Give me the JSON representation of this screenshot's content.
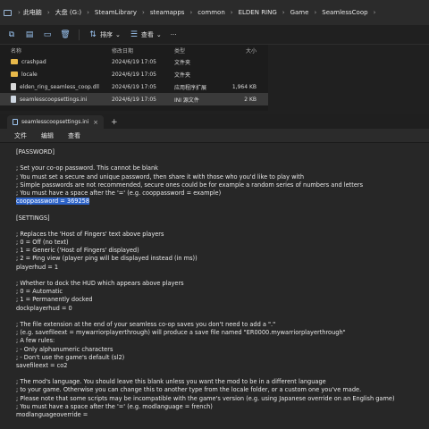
{
  "explorer": {
    "breadcrumb": [
      "此电脑",
      "大盘 (G:)",
      "SteamLibrary",
      "steamapps",
      "common",
      "ELDEN RING",
      "Game",
      "SeamlessCoop"
    ],
    "toolbar": {
      "sort_label": "排序",
      "view_label": "查看",
      "more_label": "···"
    },
    "columns": {
      "name": "名称",
      "date": "修改日期",
      "type": "类型",
      "size": "大小"
    },
    "files": [
      {
        "name": "crashpad",
        "date": "2024/6/19 17:05",
        "type": "文件夹",
        "size": "",
        "icon": "folder-icon"
      },
      {
        "name": "locale",
        "date": "2024/6/19 17:05",
        "type": "文件夹",
        "size": "",
        "icon": "folder-icon"
      },
      {
        "name": "elden_ring_seamless_coop.dll",
        "date": "2024/6/19 17:05",
        "type": "应用程序扩展",
        "size": "1,964 KB",
        "icon": "dll-file-icon"
      },
      {
        "name": "seamlesscoopsettings.ini",
        "date": "2024/6/19 17:05",
        "type": "INI 源文件",
        "size": "2 KB",
        "icon": "ini-file-icon"
      }
    ]
  },
  "notepad": {
    "tab_title": "seamlesscoopsettings.ini",
    "menu": {
      "file": "文件",
      "edit": "编辑",
      "view": "查看"
    },
    "highlight_color": "#2d63c8",
    "lines": [
      "[PASSWORD]",
      "",
      "; Set your co-op password. This cannot be blank",
      "; You must set a secure and unique password, then share it with those who you'd like to play with",
      "; Simple passwords are not recommended, secure ones could be for example a random series of numbers and letters",
      "; You must have a space after the '=' (e.g. cooppassword = example)",
      "cooppassword = 369258",
      "",
      "[SETTINGS]",
      "",
      "; Replaces the 'Host of Fingers' text above players",
      "; 0 = Off (no text)",
      "; 1 = Generic ('Host of Fingers' displayed)",
      "; 2 = Ping view (player ping will be displayed instead (in ms))",
      "playerhud = 1",
      "",
      "; Whether to dock the HUD which appears above players",
      "; 0 = Automatic",
      "; 1 = Permanently docked",
      "dockplayerhud = 0",
      "",
      "; The file extension at the end of your seamless co-op saves you don't need to add a \".\"",
      "; (e.g. savefileext = mywarriorplayerthrough) will produce a save file named \"ER0000.mywarriorplayerthrough\"",
      "; A few rules:",
      "; - Only alphanumeric characters",
      "; - Don't use the game's default (sl2)",
      "savefileext = co2",
      "",
      "; The mod's language. You should leave this blank unless you want the mod to be in a different language",
      "; to your game. Otherwise you can change this to another type from the locale folder, or a custom one you've made.",
      "; Please note that some scripts may be incompatible with the game's version (e.g. using Japanese override on an English game)",
      "; You must have a space after the '=' (e.g. modlanguage = french)",
      "modlanguageoverride ="
    ]
  }
}
